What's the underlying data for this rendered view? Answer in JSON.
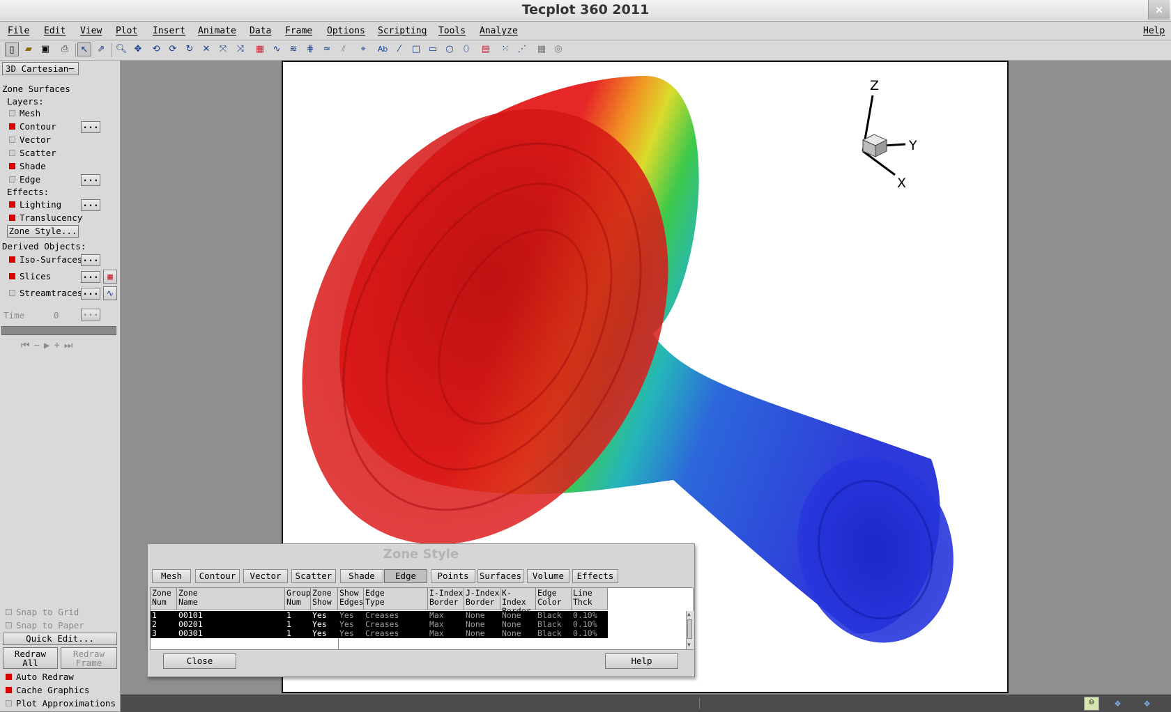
{
  "app": {
    "title": "Tecplot 360 2011",
    "close_glyph": "×"
  },
  "menu": {
    "items": [
      "File",
      "Edit",
      "View",
      "Plot",
      "Insert",
      "Animate",
      "Data",
      "Frame",
      "Options",
      "Scripting",
      "Tools",
      "Analyze"
    ],
    "help": "Help"
  },
  "sidebar": {
    "plot_type": "3D Cartesian",
    "section": "Zone Surfaces",
    "layers_label": "Layers:",
    "layers": [
      {
        "label": "Mesh",
        "on": false
      },
      {
        "label": "Contour",
        "on": true
      },
      {
        "label": "Vector",
        "on": false
      },
      {
        "label": "Scatter",
        "on": false
      },
      {
        "label": "Shade",
        "on": true
      },
      {
        "label": "Edge",
        "on": false
      }
    ],
    "effects_label": "Effects:",
    "effects": [
      {
        "label": "Lighting",
        "on": true
      },
      {
        "label": "Translucency",
        "on": true
      }
    ],
    "zone_style_btn": "Zone Style...",
    "derived_label": "Derived Objects:",
    "derived": [
      {
        "label": "Iso-Surfaces",
        "on": true
      },
      {
        "label": "Slices",
        "on": true
      },
      {
        "label": "Streamtraces",
        "on": false
      }
    ],
    "dots": "...",
    "time_label": "Time",
    "time_value": "0",
    "snap_grid": "Snap to Grid",
    "snap_paper": "Snap to Paper",
    "quick_edit": "Quick Edit...",
    "redraw_all": "Redraw\nAll",
    "redraw_frame": "Redraw\nFrame",
    "auto_redraw": "Auto Redraw",
    "cache_graphics": "Cache Graphics",
    "plot_approx": "Plot Approximations"
  },
  "axes": {
    "z": "Z",
    "y": "Y",
    "x": "X"
  },
  "dialog": {
    "title": "Zone Style",
    "tabs": [
      "Mesh",
      "Contour",
      "Vector",
      "Scatter",
      "Shade",
      "Edge",
      "Points",
      "Surfaces",
      "Volume",
      "Effects"
    ],
    "active_tab": "Edge",
    "columns": [
      "Zone\nNum",
      "Zone\nName",
      "Group\nNum",
      "Zone\nShow",
      "Show\nEdges",
      "Edge\nType",
      "I-Index\nBorder",
      "J-Index\nBorder",
      "K-Index\nBorder",
      "Edge\nColor",
      "Line\nThck"
    ],
    "rows": [
      [
        "1",
        "00101",
        "1",
        "Yes",
        "Yes",
        "Creases",
        "Max",
        "None",
        "None",
        "Black",
        "0.10%"
      ],
      [
        "2",
        "00201",
        "1",
        "Yes",
        "Yes",
        "Creases",
        "Max",
        "None",
        "None",
        "Black",
        "0.10%"
      ],
      [
        "3",
        "00301",
        "1",
        "Yes",
        "Yes",
        "Creases",
        "Max",
        "None",
        "None",
        "Black",
        "0.10%"
      ]
    ],
    "close": "Close",
    "help": "Help"
  }
}
